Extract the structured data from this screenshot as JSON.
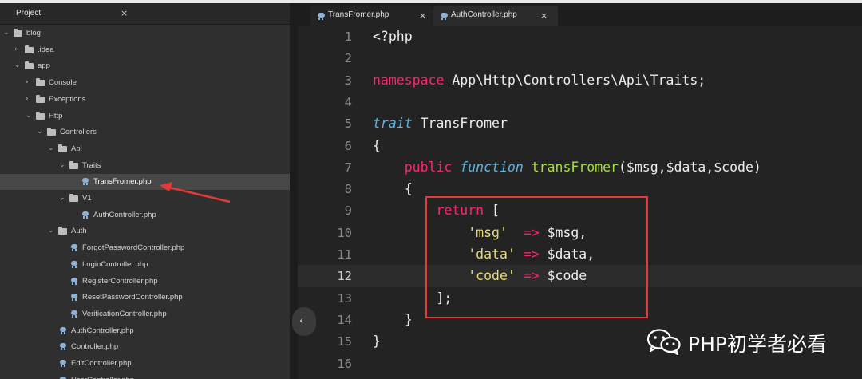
{
  "sidebar": {
    "title": "Project",
    "close_glyph": "×",
    "tree": [
      {
        "label": "blog",
        "type": "folder",
        "open": true,
        "depth": 0
      },
      {
        "label": ".idea",
        "type": "folder",
        "open": false,
        "depth": 1
      },
      {
        "label": "app",
        "type": "folder",
        "open": true,
        "depth": 1
      },
      {
        "label": "Console",
        "type": "folder",
        "open": false,
        "depth": 2
      },
      {
        "label": "Exceptions",
        "type": "folder",
        "open": false,
        "depth": 2
      },
      {
        "label": "Http",
        "type": "folder",
        "open": true,
        "depth": 2
      },
      {
        "label": "Controllers",
        "type": "folder",
        "open": true,
        "depth": 3
      },
      {
        "label": "Api",
        "type": "folder",
        "open": true,
        "depth": 4
      },
      {
        "label": "Traits",
        "type": "folder",
        "open": true,
        "depth": 5
      },
      {
        "label": "TransFromer.php",
        "type": "file",
        "selected": true,
        "depth": 6
      },
      {
        "label": "V1",
        "type": "folder",
        "open": true,
        "depth": 5
      },
      {
        "label": "AuthController.php",
        "type": "file",
        "depth": 6
      },
      {
        "label": "Auth",
        "type": "folder",
        "open": true,
        "depth": 4
      },
      {
        "label": "ForgotPasswordController.php",
        "type": "file",
        "depth": 5
      },
      {
        "label": "LoginController.php",
        "type": "file",
        "depth": 5
      },
      {
        "label": "RegisterController.php",
        "type": "file",
        "depth": 5
      },
      {
        "label": "ResetPasswordController.php",
        "type": "file",
        "depth": 5
      },
      {
        "label": "VerificationController.php",
        "type": "file",
        "depth": 5
      },
      {
        "label": "AuthController.php",
        "type": "file",
        "depth": 4
      },
      {
        "label": "Controller.php",
        "type": "file",
        "depth": 4
      },
      {
        "label": "EditController.php",
        "type": "file",
        "depth": 4
      },
      {
        "label": "UserController.php",
        "type": "file",
        "depth": 4
      }
    ]
  },
  "tabs": [
    {
      "label": "TransFromer.php",
      "active": true,
      "close_glyph": "×"
    },
    {
      "label": "AuthController.php",
      "active": false,
      "close_glyph": "×"
    }
  ],
  "collapse_glyph": "‹",
  "editor": {
    "current_line": 12,
    "lines": [
      {
        "n": "1",
        "tokens": [
          {
            "t": "<?php",
            "c": "plain"
          }
        ]
      },
      {
        "n": "2",
        "tokens": []
      },
      {
        "n": "3",
        "tokens": [
          {
            "t": "namespace",
            "c": "kw"
          },
          {
            "t": " App\\Http\\Controllers\\Api\\Traits;",
            "c": "plain"
          }
        ]
      },
      {
        "n": "4",
        "tokens": []
      },
      {
        "n": "5",
        "tokens": [
          {
            "t": "trait",
            "c": "italic"
          },
          {
            "t": " TransFromer",
            "c": "plain"
          }
        ]
      },
      {
        "n": "6",
        "tokens": [
          {
            "t": "{",
            "c": "plain"
          }
        ]
      },
      {
        "n": "7",
        "tokens": [
          {
            "t": "    ",
            "c": "plain"
          },
          {
            "t": "public",
            "c": "kw"
          },
          {
            "t": " ",
            "c": "plain"
          },
          {
            "t": "function",
            "c": "italic"
          },
          {
            "t": " ",
            "c": "plain"
          },
          {
            "t": "transFromer",
            "c": "fn"
          },
          {
            "t": "($msg,$data,$code)",
            "c": "plain"
          }
        ]
      },
      {
        "n": "8",
        "tokens": [
          {
            "t": "    {",
            "c": "plain"
          }
        ]
      },
      {
        "n": "9",
        "tokens": [
          {
            "t": "        ",
            "c": "plain"
          },
          {
            "t": "return",
            "c": "kw"
          },
          {
            "t": " [",
            "c": "plain"
          }
        ]
      },
      {
        "n": "10",
        "tokens": [
          {
            "t": "            ",
            "c": "plain"
          },
          {
            "t": "'msg'",
            "c": "str"
          },
          {
            "t": "  ",
            "c": "plain"
          },
          {
            "t": "=>",
            "c": "op"
          },
          {
            "t": " $msg,",
            "c": "plain"
          }
        ]
      },
      {
        "n": "11",
        "tokens": [
          {
            "t": "            ",
            "c": "plain"
          },
          {
            "t": "'data'",
            "c": "str"
          },
          {
            "t": " ",
            "c": "plain"
          },
          {
            "t": "=>",
            "c": "op"
          },
          {
            "t": " $data,",
            "c": "plain"
          }
        ]
      },
      {
        "n": "12",
        "tokens": [
          {
            "t": "            ",
            "c": "plain"
          },
          {
            "t": "'code'",
            "c": "str"
          },
          {
            "t": " ",
            "c": "plain"
          },
          {
            "t": "=>",
            "c": "op"
          },
          {
            "t": " $code",
            "c": "plain"
          }
        ],
        "caret": true
      },
      {
        "n": "13",
        "tokens": [
          {
            "t": "        ];",
            "c": "plain"
          }
        ]
      },
      {
        "n": "14",
        "tokens": [
          {
            "t": "    }",
            "c": "plain"
          }
        ]
      },
      {
        "n": "15",
        "tokens": [
          {
            "t": "}",
            "c": "plain"
          }
        ]
      },
      {
        "n": "16",
        "tokens": []
      }
    ]
  },
  "watermark": {
    "text": "PHP初学者必看",
    "icon": "wechat-icon"
  }
}
